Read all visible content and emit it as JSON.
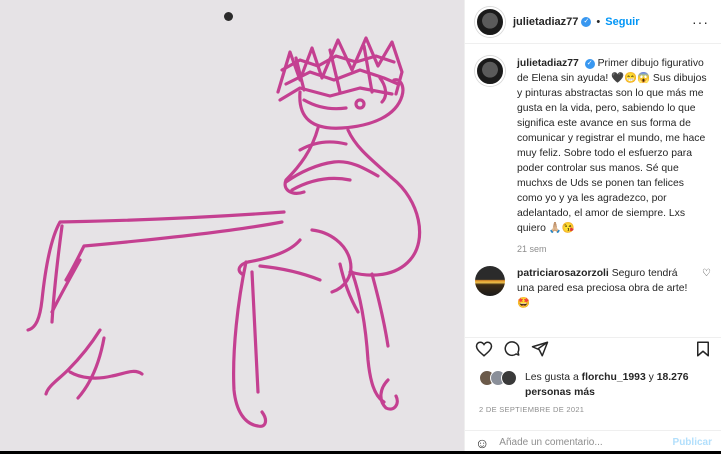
{
  "header": {
    "username": "julietadiaz77",
    "separator": "•",
    "follow_label": "Seguir",
    "more_label": "···"
  },
  "caption": {
    "username": "julietadiaz77",
    "text": "Primer dibujo figurativo de Elena sin ayuda! 🖤😁😱 Sus dibujos y pinturas abstractas son lo que más me gusta en la vida, pero, sabiendo lo que significa este avance en sus forma de comunicar y registrar el mundo, me hace muy feliz. Sobre todo el esfuerzo para poder controlar sus manos. Sé que muchxs de Uds se ponen tan felices como yo y ya les agradezco, por adelantado, el amor de siempre. Lxs quiero 🙏🏼😘",
    "time": "21 sem"
  },
  "comment": {
    "username": "patriciarosazorzoli",
    "text": "Seguro tendrá una pared esa preciosa obra de arte! 🤩"
  },
  "likes": {
    "prefix": "Les gusta a",
    "first_user": "florchu_1993",
    "connector": "y",
    "others": "18.276 personas más"
  },
  "date": "2 DE SEPTIEMBRE DE 2021",
  "add_comment": {
    "placeholder": "Añade un comentario...",
    "publish_label": "Publicar"
  },
  "icons": {
    "verified": "verified-badge-icon",
    "like": "heart-icon",
    "comment": "comment-icon",
    "share": "share-icon",
    "save": "bookmark-icon",
    "emoji": "emoji-icon"
  },
  "colors": {
    "accent": "#0095f6",
    "drawing": "#c2338a",
    "paper": "#e6e3e6"
  }
}
